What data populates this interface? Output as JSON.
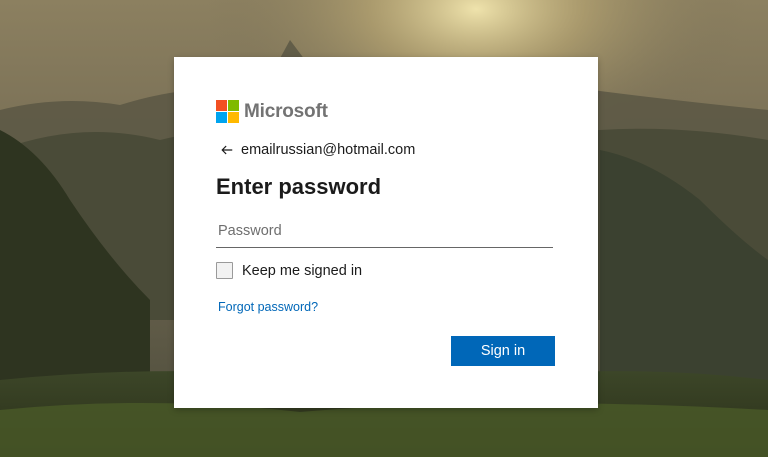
{
  "brand": {
    "name": "Microsoft",
    "logo_colors": [
      "#f25022",
      "#7fba00",
      "#00a4ef",
      "#ffb900"
    ]
  },
  "identity": {
    "email": "emailrussian@hotmail.com",
    "back_icon": "arrow-left-icon"
  },
  "form": {
    "title": "Enter password",
    "password_placeholder": "Password",
    "password_value": "",
    "keep_signed_in_label": "Keep me signed in",
    "keep_signed_in_checked": false,
    "forgot_password_label": "Forgot password?",
    "signin_label": "Sign in"
  },
  "colors": {
    "accent": "#0067b8",
    "card_background": "#ffffff"
  }
}
